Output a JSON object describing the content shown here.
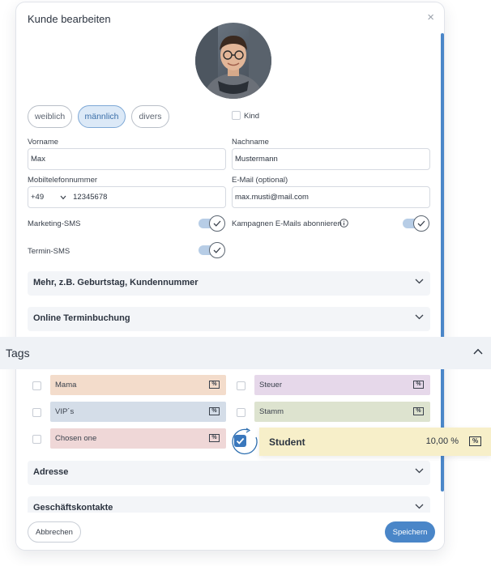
{
  "modal": {
    "title": "Kunde bearbeiten",
    "close": "×"
  },
  "gender": {
    "options": [
      "weiblich",
      "männlich",
      "divers"
    ],
    "selected": "männlich"
  },
  "kind": {
    "label": "Kind"
  },
  "form": {
    "first_name": {
      "label": "Vorname",
      "value": "Max"
    },
    "last_name": {
      "label": "Nachname",
      "value": "Mustermann"
    },
    "mobile": {
      "label": "Mobiltelefonnummer",
      "prefix": "+49",
      "value": "12345678"
    },
    "email": {
      "label": "E-Mail (optional)",
      "value": "max.musti@mail.com"
    }
  },
  "toggles": {
    "marketing_sms": {
      "label": "Marketing-SMS",
      "on": true
    },
    "campaign_emails": {
      "label": "Kampagnen E-Mails abonnieren",
      "on": true
    },
    "termin_sms": {
      "label": "Termin-SMS",
      "on": true
    }
  },
  "sections": {
    "more": "Mehr, z.B. Geburtstag, Kundennummer",
    "online": "Online Terminbuchung",
    "tags": "Tags",
    "address": "Adresse",
    "business": "Geschäftskontakte"
  },
  "tags": [
    {
      "name": "Mama",
      "color": "#f3dccb"
    },
    {
      "name": "Steuer",
      "color": "#e6d8ea"
    },
    {
      "name": "VIP´s",
      "color": "#d4dde8"
    },
    {
      "name": "Stamm",
      "color": "#dde3cf"
    },
    {
      "name": "Chosen one",
      "color": "#efd7d7"
    }
  ],
  "student": {
    "name": "Student",
    "value": "10,00 %",
    "color": "#f7efc9",
    "checked": true
  },
  "icons": {
    "percent": "%"
  },
  "footer": {
    "cancel": "Abbrechen",
    "save": "Speichern"
  },
  "colors": {
    "accent": "#4a86c8"
  }
}
